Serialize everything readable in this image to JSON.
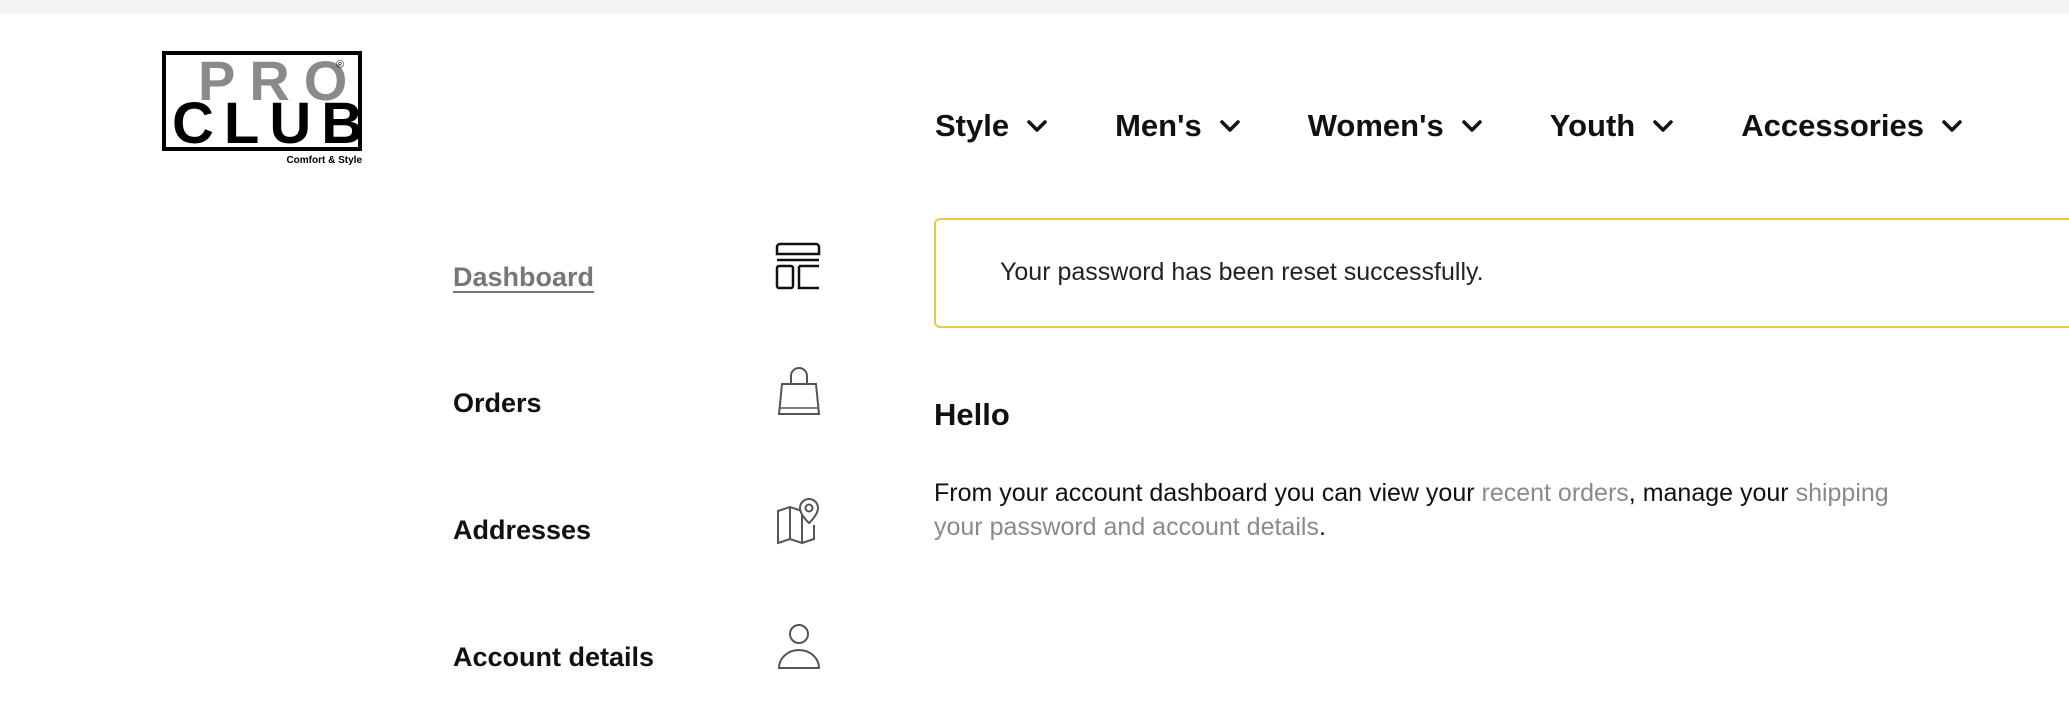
{
  "logo": {
    "top": "PRO",
    "bottom": "CLUB",
    "registered": "®",
    "tagline": "Comfort & Style"
  },
  "nav": {
    "items": [
      {
        "label": "Style"
      },
      {
        "label": "Men's"
      },
      {
        "label": "Women's"
      },
      {
        "label": "Youth"
      },
      {
        "label": "Accessories"
      }
    ]
  },
  "sidebar": {
    "items": [
      {
        "label": "Dashboard",
        "icon": "dashboard-icon",
        "active": true
      },
      {
        "label": "Orders",
        "icon": "shopping-bag-icon",
        "active": false
      },
      {
        "label": "Addresses",
        "icon": "map-pin-icon",
        "active": false
      },
      {
        "label": "Account details",
        "icon": "user-icon",
        "active": false
      }
    ]
  },
  "alert": {
    "message": "Your password has been reset successfully.",
    "border_color": "#f2c44a"
  },
  "main": {
    "greeting": "Hello",
    "intro": {
      "part1": "From your account dashboard you can view your ",
      "link_orders": "recent orders",
      "part2": ", manage your ",
      "link_shipping": "shipping",
      "link_password": "your password and account details",
      "part3": "."
    }
  },
  "colors": {
    "link_gray": "#8a8a8a",
    "text": "#111111",
    "alert_border": "#f2c44a"
  }
}
